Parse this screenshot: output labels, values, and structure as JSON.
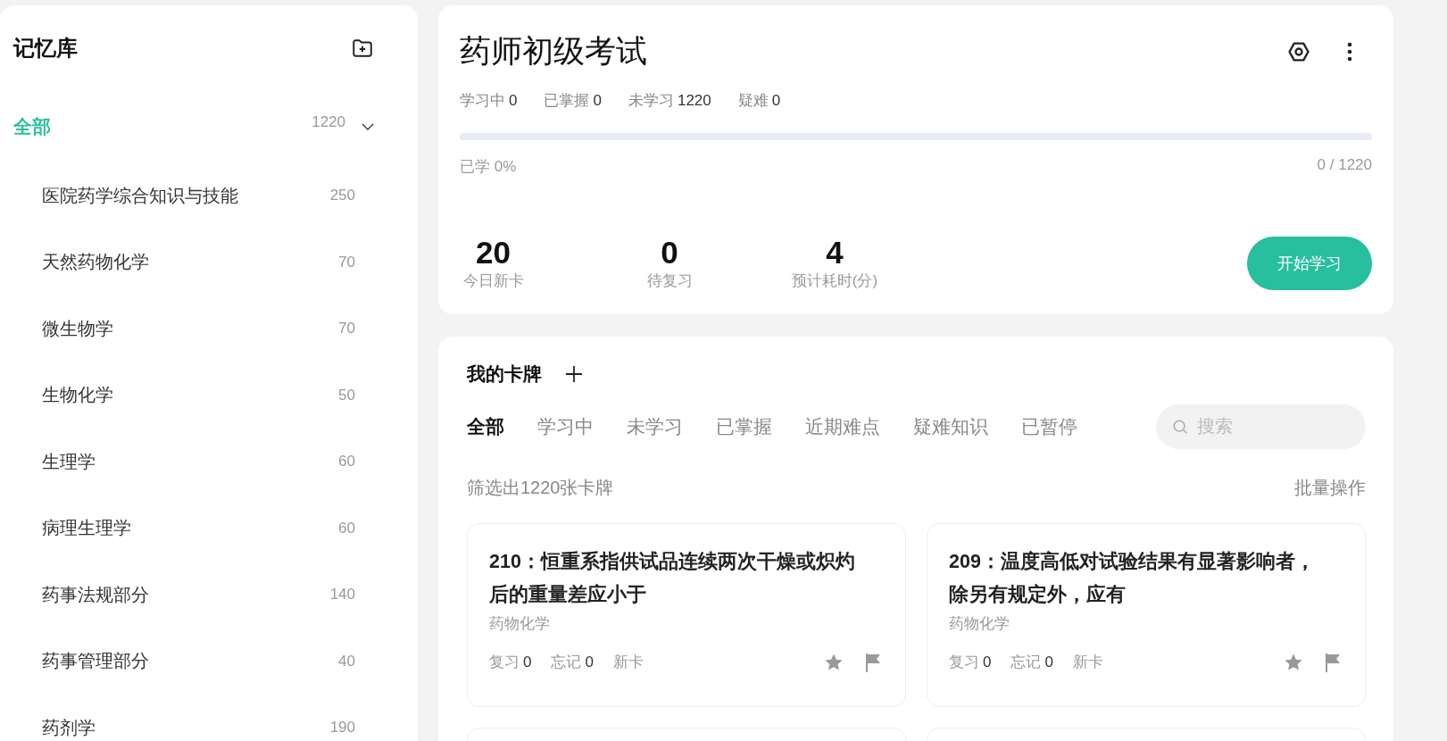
{
  "sidebar": {
    "title": "记忆库",
    "root": {
      "label": "全部",
      "count": "1220",
      "selected": true,
      "expanded": true,
      "children": [
        {
          "label": "医院药学综合知识与技能",
          "count": "250",
          "selected": false
        },
        {
          "label": "天然药物化学",
          "count": "70",
          "selected": false
        },
        {
          "label": "微生物学",
          "count": "70",
          "selected": false
        },
        {
          "label": "生物化学",
          "count": "50",
          "selected": false
        },
        {
          "label": "生理学",
          "count": "60",
          "selected": false
        },
        {
          "label": "病理生理学",
          "count": "60",
          "selected": false
        },
        {
          "label": "药事法规部分",
          "count": "140",
          "selected": false
        },
        {
          "label": "药事管理部分",
          "count": "40",
          "selected": false
        },
        {
          "label": "药剂学",
          "count": "190",
          "selected": false
        }
      ]
    }
  },
  "deck": {
    "title": "药师初级考试",
    "stats": [
      {
        "label": "学习中",
        "value": "0"
      },
      {
        "label": "已掌握",
        "value": "0"
      },
      {
        "label": "未学习",
        "value": "1220"
      },
      {
        "label": "疑难",
        "value": "0"
      }
    ],
    "progress": {
      "level": 0,
      "label": "已学 0%",
      "reading": "0 / 1220"
    },
    "summary": [
      {
        "value": "20",
        "label": "今日新卡"
      },
      {
        "value": "0",
        "label": "待复习"
      },
      {
        "value": "4",
        "label": "预计耗时(分)"
      }
    ],
    "start_button": "开始学习"
  },
  "cards_panel": {
    "title": "我的卡牌",
    "tabs": [
      {
        "label": "全部",
        "selected": true
      },
      {
        "label": "学习中",
        "selected": false
      },
      {
        "label": "未学习",
        "selected": false
      },
      {
        "label": "已掌握",
        "selected": false
      },
      {
        "label": "近期难点",
        "selected": false
      },
      {
        "label": "疑难知识",
        "selected": false
      },
      {
        "label": "已暂停",
        "selected": false
      }
    ],
    "search": {
      "placeholder": "搜索"
    },
    "filter_summary": "筛选出1220张卡牌",
    "batch_action": "批量操作",
    "cards": [
      {
        "question": "210：恒重系指供试品连续两次干燥或炽灼后的重量差应小于",
        "category": "药物化学",
        "stats": [
          {
            "label": "复习",
            "value": "0"
          },
          {
            "label": "忘记",
            "value": "0"
          }
        ],
        "status": "新卡"
      },
      {
        "question": "209：温度高低对试验结果有显著影响者，除另有规定外，应有",
        "category": "药物化学",
        "stats": [
          {
            "label": "复习",
            "value": "0"
          },
          {
            "label": "忘记",
            "value": "0"
          }
        ],
        "status": "新卡"
      }
    ]
  }
}
